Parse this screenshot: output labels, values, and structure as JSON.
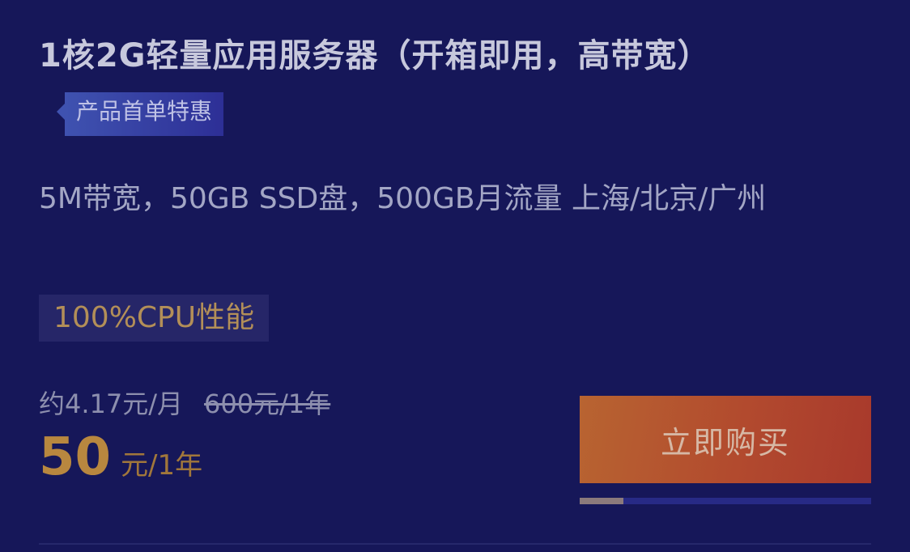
{
  "product": {
    "title": "1核2G轻量应用服务器（开箱即用，高带宽）",
    "promo_tag": "产品首单特惠",
    "description": "5M带宽，50GB SSD盘，500GB月流量 上海/北京/广州",
    "feature_tag": "100%CPU性能"
  },
  "pricing": {
    "monthly_estimate": "约4.17元/月",
    "original_price": "600元/1年",
    "price_amount": "50",
    "price_unit": "元/1年"
  },
  "actions": {
    "buy_label": "立即购买"
  },
  "stock_progress": {
    "fraction": 0.15
  },
  "colors": {
    "background": "#161759",
    "accent_gold": "#b8873f",
    "button_orange": "#b24a2e",
    "promo_blue": "#3f52b0"
  }
}
